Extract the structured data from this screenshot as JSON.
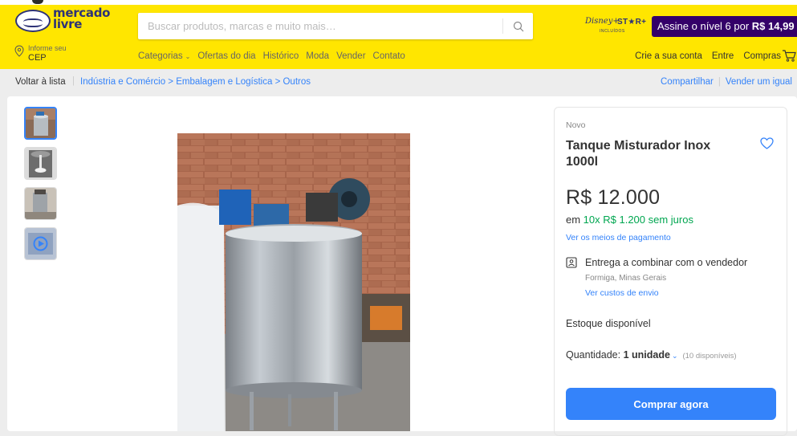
{
  "header": {
    "logo_text_line1": "mercado",
    "logo_text_line2": "livre",
    "search_placeholder": "Buscar produtos, marcas e muito mais…",
    "disney_badge": {
      "line1": "Disney+",
      "line2": "ST★R+",
      "line3": "INCLUÍDOS"
    },
    "promo_text": "Assine o nível 6 por ",
    "promo_price": "R$ 14,99",
    "cep_line1": "Informe seu",
    "cep_line2": "CEP",
    "nav": [
      "Categorias",
      "Ofertas do dia",
      "Histórico",
      "Moda",
      "Vender",
      "Contato"
    ],
    "user_links": [
      "Crie a sua conta",
      "Entre",
      "Compras"
    ]
  },
  "breadcrumb": {
    "back": "Voltar à lista",
    "path": "Indústria e Comércio > Embalagem e Logística > Outros",
    "share": "Compartilhar",
    "sell_same": "Vender um igual"
  },
  "gallery": {
    "thumb_count": 4
  },
  "product": {
    "condition": "Novo",
    "title": "Tanque Misturador Inox 1000l",
    "price": "R$ 12.000",
    "installments_prefix": "em ",
    "installments_green": "10x R$ 1.200 sem juros",
    "payment_link": "Ver os meios de pagamento",
    "shipping": "Entrega a combinar com o vendedor",
    "location": "Formiga, Minas Gerais",
    "shipping_link": "Ver custos de envio",
    "stock": "Estoque disponível",
    "quantity_label": "Quantidade: ",
    "quantity_value": "1 unidade",
    "quantity_available": "(10 disponíveis)",
    "buy_button": "Comprar agora"
  },
  "colors": {
    "header_yellow": "#ffe600",
    "link_blue": "#3483fa",
    "green": "#00a650",
    "promo_purple": "#340069"
  }
}
